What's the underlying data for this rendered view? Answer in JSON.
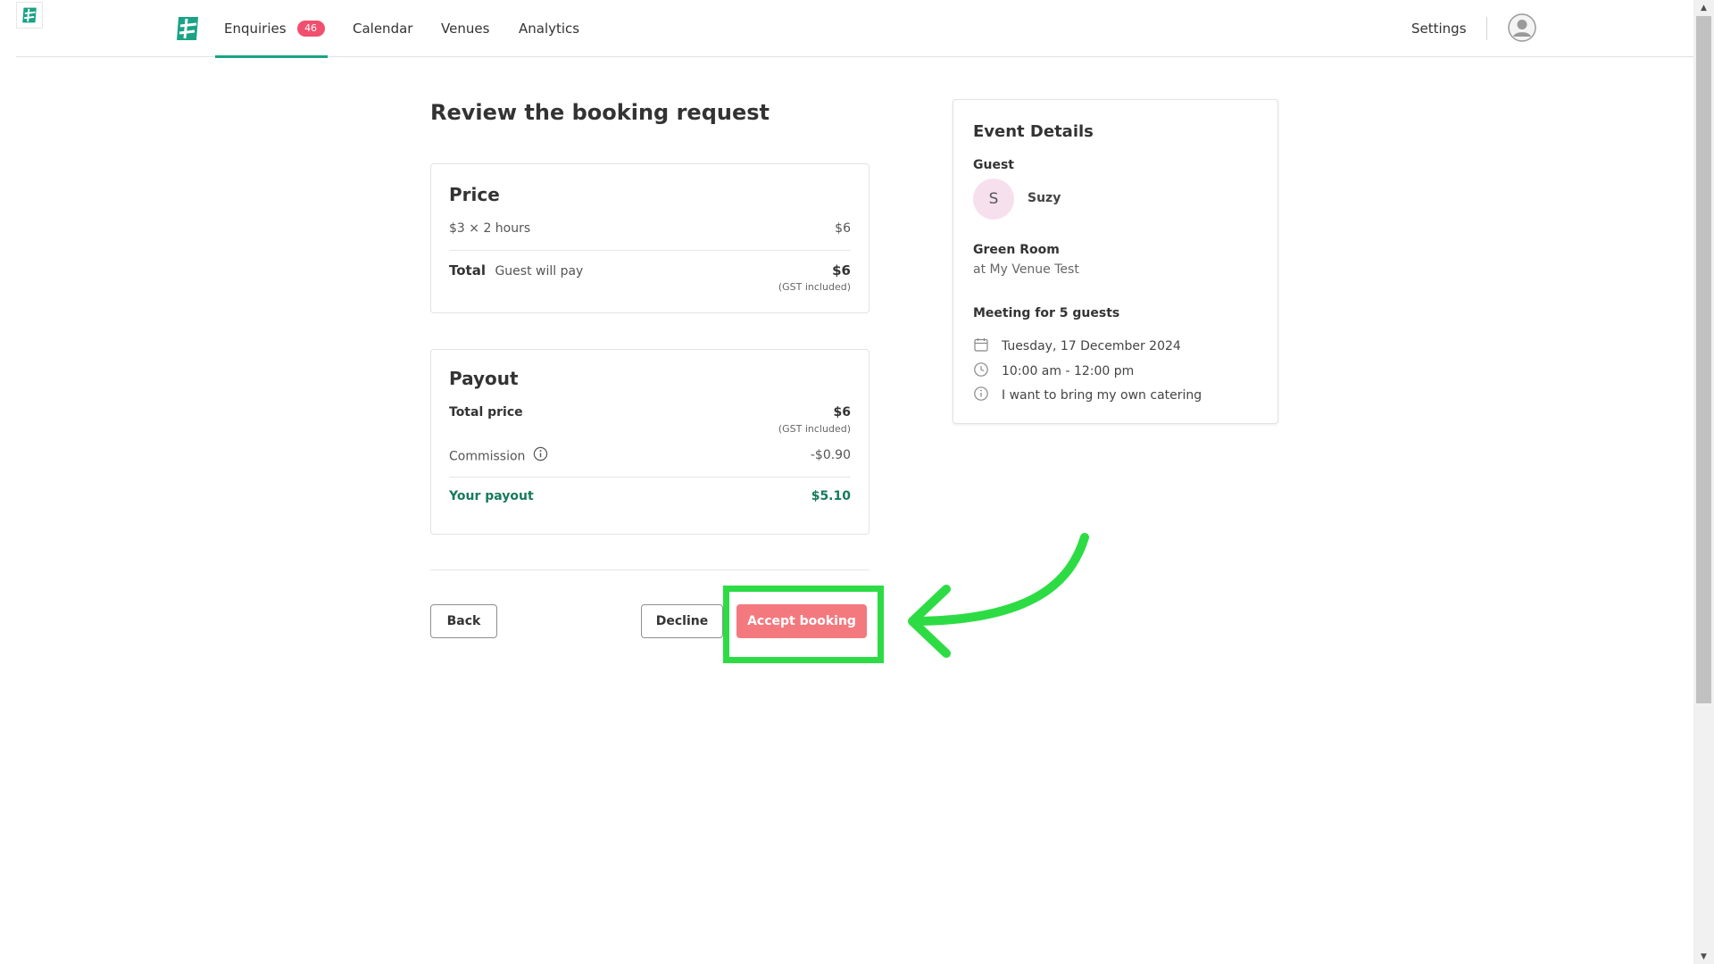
{
  "nav": {
    "tabs": [
      {
        "label": "Enquiries",
        "badge": "46",
        "active": true
      },
      {
        "label": "Calendar"
      },
      {
        "label": "Venues"
      },
      {
        "label": "Analytics"
      }
    ],
    "settings_label": "Settings",
    "logo_icon": "brand-logo-icon",
    "avatar_icon": "user-avatar-icon"
  },
  "page_title": "Review the booking request",
  "price": {
    "title": "Price",
    "line_label": "$3 × 2 hours",
    "line_value": "$6",
    "total_label": "Total",
    "total_note": "Guest will pay",
    "total_value": "$6",
    "gst_note": "(GST included)"
  },
  "payout": {
    "title": "Payout",
    "total_price_label": "Total price",
    "total_price_value": "$6",
    "gst_note": "(GST included)",
    "commission_label": "Commission",
    "commission_value": "-$0.90",
    "your_payout_label": "Your payout",
    "your_payout_value": "$5.10"
  },
  "actions": {
    "back": "Back",
    "decline": "Decline",
    "accept": "Accept booking"
  },
  "event": {
    "title": "Event Details",
    "guest_label": "Guest",
    "guest_initial": "S",
    "guest_name": "Suzy",
    "room": "Green Room",
    "venue": "at My Venue Test",
    "meeting": "Meeting for 5 guests",
    "date": "Tuesday, 17 December 2024",
    "time": "10:00 am - 12:00 pm",
    "note": "I want to bring my own catering"
  },
  "colors": {
    "brand_green": "#1aa385",
    "badge_red": "#f0506e",
    "accept_pink": "#f4797f",
    "payout_green": "#177a5c",
    "annotation_green": "#2ddc44"
  }
}
